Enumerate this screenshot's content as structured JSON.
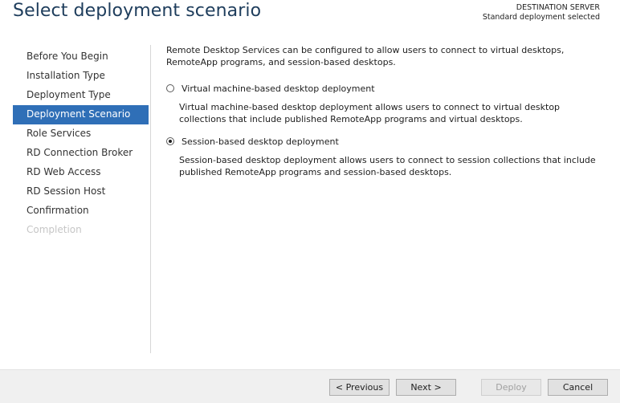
{
  "header": {
    "title": "Select deployment scenario",
    "destination_label": "DESTINATION SERVER",
    "destination_value": "Standard deployment selected"
  },
  "nav": {
    "items": [
      {
        "label": "Before You Begin",
        "state": "normal"
      },
      {
        "label": "Installation Type",
        "state": "normal"
      },
      {
        "label": "Deployment Type",
        "state": "normal"
      },
      {
        "label": "Deployment Scenario",
        "state": "active"
      },
      {
        "label": "Role Services",
        "state": "normal"
      },
      {
        "label": "RD Connection Broker",
        "state": "normal"
      },
      {
        "label": "RD Web Access",
        "state": "normal"
      },
      {
        "label": "RD Session Host",
        "state": "normal"
      },
      {
        "label": "Confirmation",
        "state": "normal"
      },
      {
        "label": "Completion",
        "state": "disabled"
      }
    ]
  },
  "content": {
    "intro": "Remote Desktop Services can be configured to allow users to connect to virtual desktops, RemoteApp programs, and session-based desktops.",
    "options": [
      {
        "label": "Virtual machine-based desktop deployment",
        "description": "Virtual machine-based desktop deployment allows users to connect to virtual desktop collections that include published RemoteApp programs and virtual desktops.",
        "selected": false
      },
      {
        "label": "Session-based desktop deployment",
        "description": "Session-based desktop deployment allows users to connect to session collections that include published RemoteApp programs and session-based desktops.",
        "selected": true
      }
    ]
  },
  "footer": {
    "previous_label": "< Previous",
    "next_label": "Next >",
    "deploy_label": "Deploy",
    "cancel_label": "Cancel",
    "deploy_enabled": false
  },
  "colors": {
    "title": "#1e3d5c",
    "nav_active_bg": "#2f6fb7",
    "nav_disabled_text": "#c6c6c6",
    "footer_bg": "#f0f0f0"
  }
}
